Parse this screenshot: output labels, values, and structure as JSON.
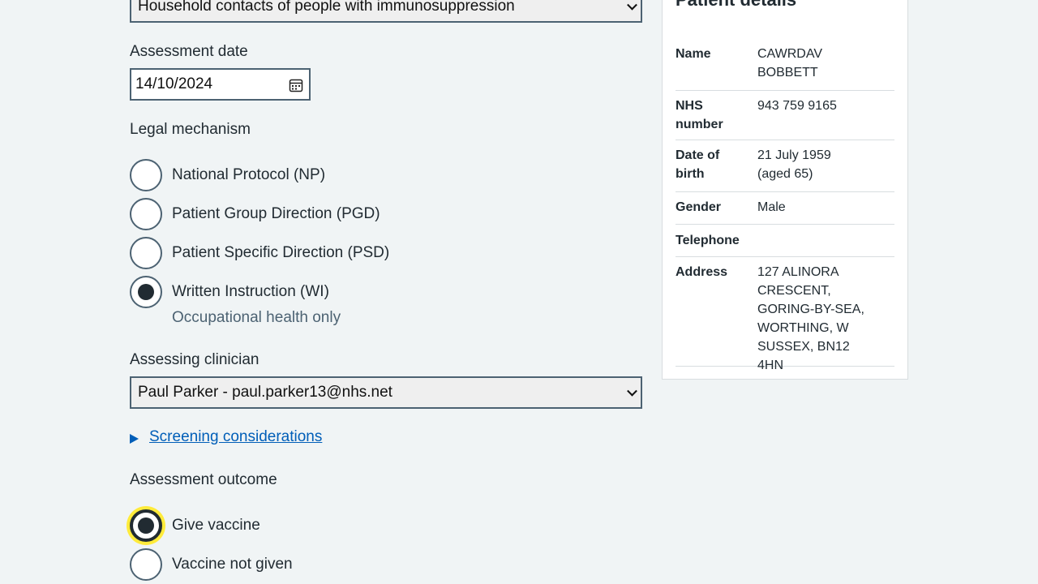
{
  "form": {
    "group_select_value": "Household contacts of people with immunosuppression",
    "assessment_date_label": "Assessment date",
    "assessment_date_value": "14/10/2024",
    "legal_mechanism_label": "Legal mechanism",
    "legal_mechanism_options": [
      {
        "label": "National Protocol (NP)",
        "checked": false
      },
      {
        "label": "Patient Group Direction (PGD)",
        "checked": false
      },
      {
        "label": "Patient Specific Direction (PSD)",
        "checked": false
      },
      {
        "label": "Written Instruction (WI)",
        "checked": true,
        "hint": "Occupational health only"
      }
    ],
    "assessing_clinician_label": "Assessing clinician",
    "assessing_clinician_value": "Paul Parker - paul.parker13@nhs.net",
    "screening_link": "Screening considerations",
    "assessment_outcome_label": "Assessment outcome",
    "assessment_outcome_options": [
      {
        "label": "Give vaccine",
        "checked": true
      },
      {
        "label": "Vaccine not given",
        "checked": false
      }
    ]
  },
  "patient": {
    "title": "Patient details",
    "rows": [
      {
        "key": "Name",
        "value": "CAWRDAV BOBBETT"
      },
      {
        "key": "NHS number",
        "value": "943 759 9165"
      },
      {
        "key": "Date of birth",
        "value": "21 July 1959 (aged 65)"
      },
      {
        "key": "Gender",
        "value": "Male"
      },
      {
        "key": "Telephone",
        "value": ""
      },
      {
        "key": "Address",
        "value": "127 ALINORA CRESCENT, GORING-BY-SEA, WORTHING, W SUSSEX, BN12 4HN"
      }
    ]
  },
  "colors": {
    "page_bg": "#f0f4f5",
    "text": "#212b32",
    "link": "#005eb8",
    "border": "#4c6272",
    "focus": "#ffeb3b"
  }
}
